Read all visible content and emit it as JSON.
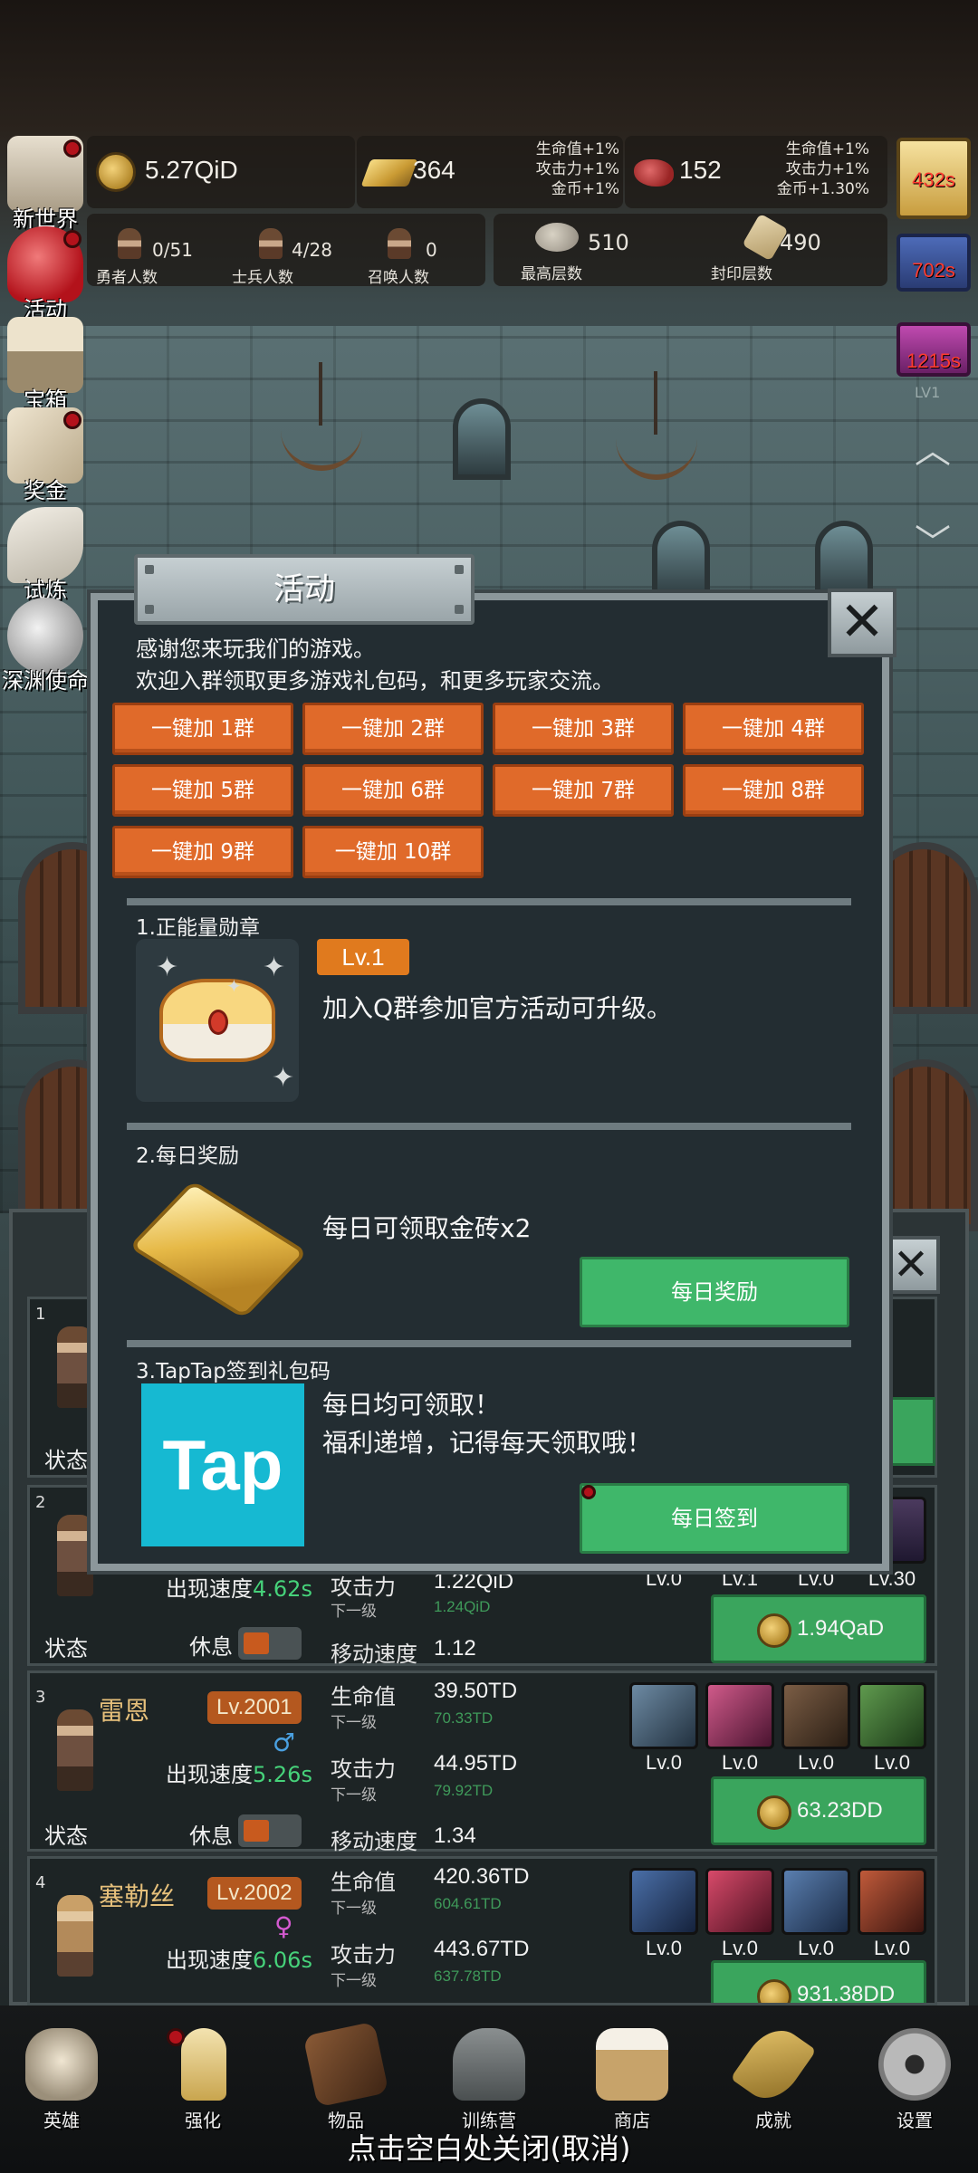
{
  "resources": {
    "coins": "5.27QiD",
    "gold_bricks": "364",
    "gold_bricks_bonus": [
      "生命值+1%",
      "攻击力+1%",
      "金币+1%"
    ],
    "meat": "152",
    "meat_bonus": [
      "生命值+1%",
      "攻击力+1%",
      "金币+1.30%"
    ],
    "hero_count": "0/51",
    "hero_count_label": "勇者人数",
    "soldier_count": "4/28",
    "soldier_count_label": "士兵人数",
    "summon_count": "0",
    "summon_count_label": "召唤人数",
    "max_floor": "510",
    "max_floor_label": "最高层数",
    "seal_floor": "490",
    "seal_floor_label": "封印层数"
  },
  "side_menu": [
    {
      "label": "新世界",
      "has_dot": true
    },
    {
      "label": "活动",
      "has_dot": true
    },
    {
      "label": "宝箱",
      "has_dot": false
    },
    {
      "label": "奖金",
      "has_dot": true
    },
    {
      "label": "试炼",
      "has_dot": false
    },
    {
      "label": "深渊使命",
      "has_dot": false
    }
  ],
  "timers": [
    "432s",
    "702s",
    "1215s"
  ],
  "timer_small": "LV1",
  "hero_list": [
    {
      "num": "1",
      "status": "状态"
    },
    {
      "num": "2",
      "speed_label": "出现速度",
      "speed": "4.62s",
      "status": "状态",
      "rest": "休息",
      "atk_label": "攻击力",
      "atk": "1.22QiD",
      "next_label": "下一级",
      "atk_next": "1.24QiD",
      "move_label": "移动速度",
      "move": "1.12",
      "skill_levels": [
        "Lv.0",
        "Lv.1",
        "Lv.0",
        "Lv.30"
      ],
      "upgrade_cost": "1.94QaD"
    },
    {
      "num": "3",
      "name": "雷恩",
      "level": "Lv.2001",
      "gender": "♂",
      "speed_label": "出现速度",
      "speed": "5.26s",
      "status": "状态",
      "rest": "休息",
      "hp_label": "生命值",
      "hp": "39.50TD",
      "hp_next": "70.33TD",
      "atk_label": "攻击力",
      "atk": "44.95TD",
      "atk_next": "79.92TD",
      "next_label": "下一级",
      "move_label": "移动速度",
      "move": "1.34",
      "skill_levels": [
        "Lv.0",
        "Lv.0",
        "Lv.0",
        "Lv.0"
      ],
      "upgrade_cost": "63.23DD"
    },
    {
      "num": "4",
      "name": "塞勒丝",
      "level": "Lv.2002",
      "gender": "♀",
      "speed_label": "出现速度",
      "speed": "6.06s",
      "hp_label": "生命值",
      "hp": "420.36TD",
      "hp_next": "604.61TD",
      "atk_label": "攻击力",
      "atk": "443.67TD",
      "atk_next": "637.78TD",
      "next_label": "下一级",
      "skill_levels": [
        "Lv.0",
        "Lv.0",
        "Lv.0",
        "Lv.0"
      ],
      "upgrade_cost": "931.38DD"
    }
  ],
  "bottom_nav": [
    "英雄",
    "强化",
    "物品",
    "训练营",
    "商店",
    "成就",
    "设置"
  ],
  "close_hint": "点击空白处关闭(取消)",
  "modal": {
    "title": "活动",
    "welcome_line1": "感谢您来玩我们的游戏。",
    "welcome_line2": "欢迎入群领取更多游戏礼包码，和更多玩家交流。",
    "group_buttons": [
      "一键加 1群",
      "一键加 2群",
      "一键加 3群",
      "一键加 4群",
      "一键加 5群",
      "一键加 6群",
      "一键加 7群",
      "一键加 8群",
      "一键加 9群",
      "一键加 10群"
    ],
    "section1": {
      "title": "1.正能量勋章",
      "badge": "Lv.1",
      "text": "加入Q群参加官方活动可升级。"
    },
    "section2": {
      "title": "2.每日奖励",
      "text": "每日可领取金砖x2",
      "button": "每日奖励"
    },
    "section3": {
      "title": "3.TapTap签到礼包码",
      "text1": "每日均可领取！",
      "text2": "福利递增，记得每天领取哦！",
      "button": "每日签到",
      "logo_text": "Tap"
    }
  }
}
